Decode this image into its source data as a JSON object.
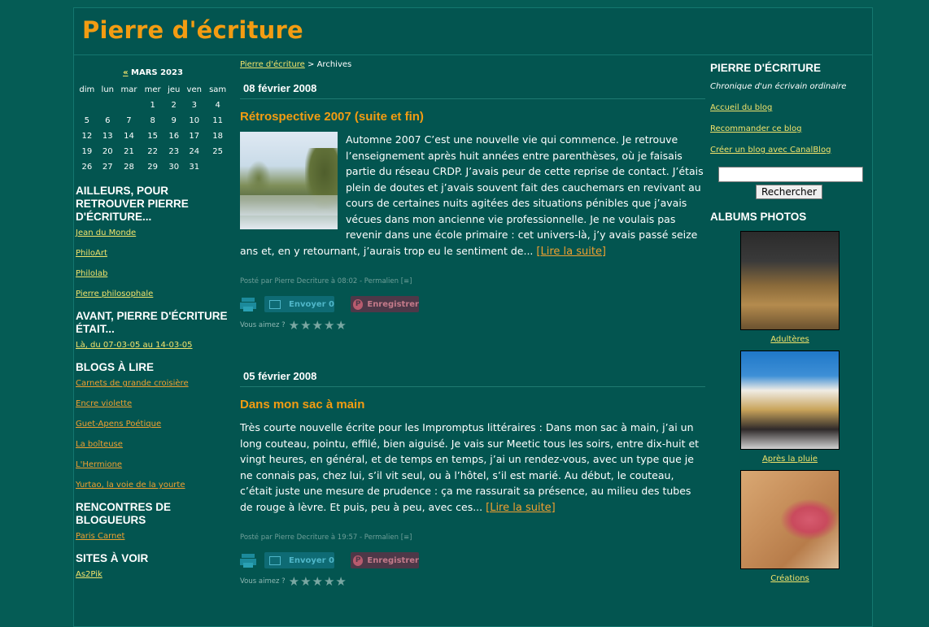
{
  "site": {
    "title": "Pierre d'écriture"
  },
  "calendar": {
    "prev": "«",
    "month": "MARS 2023",
    "weekdays": [
      "dim",
      "lun",
      "mar",
      "mer",
      "jeu",
      "ven",
      "sam"
    ],
    "weeks": [
      [
        "",
        "",
        "",
        "1",
        "2",
        "3",
        "4"
      ],
      [
        "5",
        "6",
        "7",
        "8",
        "9",
        "10",
        "11"
      ],
      [
        "12",
        "13",
        "14",
        "15",
        "16",
        "17",
        "18"
      ],
      [
        "19",
        "20",
        "21",
        "22",
        "23",
        "24",
        "25"
      ],
      [
        "26",
        "27",
        "28",
        "29",
        "30",
        "31",
        ""
      ]
    ]
  },
  "left_sections": [
    {
      "title": "AILLEURS, POUR RETROUVER PIERRE D'ÉCRITURE...",
      "links": [
        "Jean du Monde",
        "PhiloArt",
        "Philolab",
        "Pierre philosophale"
      ],
      "color": "yellow"
    },
    {
      "title": "AVANT, PIERRE D'ÉCRITURE ÉTAIT...",
      "links": [
        "Là, du 07-03-05 au 14-03-05"
      ],
      "color": "yellow"
    },
    {
      "title": "BLOGS À LIRE",
      "links": [
        "Carnets de grande croisière",
        "Encre violette",
        "Guet-Apens Poétique",
        "La boîteuse",
        "L'Hermione",
        "Yurtao, la voie de la yourte"
      ],
      "color": "orange"
    },
    {
      "title": "RENCONTRES DE BLOGUEURS",
      "links": [
        "Paris Carnet"
      ],
      "color": "orange"
    },
    {
      "title": "SITES À VOIR",
      "links": [
        "As2Pik"
      ],
      "color": "yellow"
    }
  ],
  "breadcrumb": {
    "home": "Pierre d'écriture",
    "sep": " > ",
    "current": "Archives"
  },
  "posts": [
    {
      "date": "08 février 2008",
      "title": "Rétrospective 2007 (suite et fin)",
      "body": "Automne 2007 C’est une nouvelle vie qui commence. Je retrouve l’enseignement après huit années entre parenthèses, où je faisais partie du réseau CRDP. J’avais peur de cette reprise de contact. J’étais plein de doutes et j’avais souvent fait des cauchemars en revivant au cours de certaines nuits agitées des situations pénibles que j’avais vécues dans mon ancienne vie professionnelle. Je ne voulais pas revenir dans une école primaire : cet univers-là, j’y avais passé seize ans et, en y retournant, j’aurais trop eu le sentiment de...",
      "readmore": "[Lire la suite]",
      "meta": "Posté par Pierre Decriture à 08:02 - Permalien",
      "has_image": true
    },
    {
      "date": "05 février 2008",
      "title": "Dans mon sac à main",
      "body": "Très courte nouvelle écrite pour les Impromptus littéraires :       Dans mon sac à main, j’ai un long couteau, pointu, effilé, bien aiguisé. Je vais sur Meetic tous les soirs, entre dix-huit et vingt heures, en général,  et de temps en temps, j’ai un rendez-vous, avec un type que je ne connais pas, chez lui, s’il vit seul, ou à l’hôtel, s’il est marié. Au début, le couteau, c’était juste une mesure de prudence : ça me rassurait sa présence, au milieu des tubes de rouge à lèvre. Et puis, peu à peu, avec ces...",
      "readmore": "[Lire la suite]",
      "meta": "Posté par Pierre Decriture à 19:57 - Permalien",
      "has_image": false
    }
  ],
  "post_actions": {
    "send": "Envoyer 0",
    "pin": "Enregistrer",
    "rate": "Vous aimez ?",
    "stars": "★★★★★"
  },
  "right": {
    "title": "PIERRE D'ÉCRITURE",
    "tagline": "Chronique d'un écrivain ordinaire",
    "links": [
      "Accueil du blog",
      "Recommander ce blog",
      "Créer un blog avec CanalBlog"
    ],
    "search_button": "Recherche",
    "search_button_full": "Rechercher",
    "albums_title": "ALBUMS PHOTOS",
    "albums": [
      "Adultères",
      "Après la pluie",
      "Créations"
    ]
  },
  "colors": {
    "background": "#055c55",
    "title": "#f39c12",
    "link_yellow": "#f2e36b",
    "link_orange": "#f0a030"
  }
}
